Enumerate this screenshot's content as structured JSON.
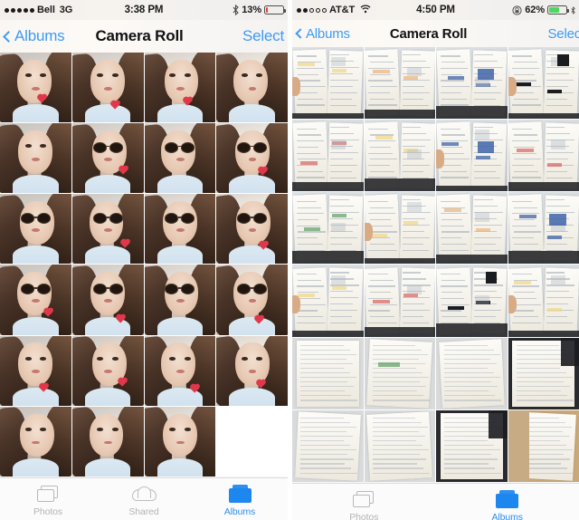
{
  "left_phone": {
    "status_bar": {
      "signal_dots": [
        true,
        true,
        true,
        true,
        true
      ],
      "carrier": "Bell",
      "network": "3G",
      "time": "3:38 PM",
      "bluetooth_icon": "bluetooth-icon",
      "battery_percent": "13%",
      "battery_level": 13,
      "battery_color": "#e8413a"
    },
    "nav_bar": {
      "back_label": "Albums",
      "back_icon": "chevron-left-icon",
      "title": "Camera Roll",
      "select_label": "Select",
      "accent_color": "#3e9bf5"
    },
    "grid": {
      "columns": 4,
      "photo_type": "selfie",
      "photos": [
        {
          "variant": "plain",
          "heart": true
        },
        {
          "variant": "plain",
          "heart": true
        },
        {
          "variant": "plain",
          "heart": true
        },
        {
          "variant": "plain",
          "heart": false
        },
        {
          "variant": "plain",
          "heart": false
        },
        {
          "variant": "shades",
          "heart": true
        },
        {
          "variant": "shades",
          "heart": false
        },
        {
          "variant": "shades",
          "heart": true
        },
        {
          "variant": "shades",
          "heart": false
        },
        {
          "variant": "shades",
          "heart": true
        },
        {
          "variant": "shades",
          "heart": false
        },
        {
          "variant": "shades",
          "heart": true
        },
        {
          "variant": "shades",
          "heart": true
        },
        {
          "variant": "shades",
          "heart": true
        },
        {
          "variant": "shades",
          "heart": false
        },
        {
          "variant": "shades",
          "heart": true
        },
        {
          "variant": "plain",
          "heart": true
        },
        {
          "variant": "plain",
          "heart": true
        },
        {
          "variant": "plain",
          "heart": true
        },
        {
          "variant": "plain",
          "heart": true
        },
        {
          "variant": "plain",
          "heart": false
        },
        {
          "variant": "plain",
          "heart": false
        },
        {
          "variant": "plain",
          "heart": false
        },
        {
          "variant": "empty",
          "heart": false
        }
      ]
    },
    "tab_bar": {
      "tabs": [
        {
          "label": "Photos",
          "icon": "photos-stack-icon",
          "active": false
        },
        {
          "label": "Shared",
          "icon": "cloud-icon",
          "active": false
        },
        {
          "label": "Albums",
          "icon": "album-folder-icon",
          "active": true
        }
      ],
      "active_color": "#2f8ff0",
      "inactive_color": "#b4b4b4"
    }
  },
  "right_phone": {
    "status_bar": {
      "signal_dots": [
        true,
        true,
        false,
        false,
        false
      ],
      "carrier": "AT&T",
      "wifi_icon": "wifi-icon",
      "time": "4:50 PM",
      "rotation_lock_icon": "rotation-lock-icon",
      "battery_percent": "62%",
      "battery_level": 62,
      "battery_color": "#4cd763"
    },
    "nav_bar": {
      "back_label": "Albums",
      "back_icon": "chevron-left-icon",
      "title": "Camera Roll",
      "select_label": "Select",
      "accent_color": "#3e9bf5"
    },
    "grid": {
      "columns": 4,
      "photo_type": "notebook-page",
      "photos": [
        {
          "variant": "spread",
          "accent": "yellow"
        },
        {
          "variant": "spread",
          "accent": "orange"
        },
        {
          "variant": "spread",
          "accent": "blue"
        },
        {
          "variant": "spread",
          "accent": "dark"
        },
        {
          "variant": "spread",
          "accent": "red"
        },
        {
          "variant": "spread",
          "accent": "yellow"
        },
        {
          "variant": "spread",
          "accent": "blue"
        },
        {
          "variant": "spread",
          "accent": "red"
        },
        {
          "variant": "spread",
          "accent": "green"
        },
        {
          "variant": "spread",
          "accent": "yellow"
        },
        {
          "variant": "spread",
          "accent": "orange"
        },
        {
          "variant": "spread",
          "accent": "blue"
        },
        {
          "variant": "spread",
          "accent": "yellow"
        },
        {
          "variant": "spread",
          "accent": "red"
        },
        {
          "variant": "spread",
          "accent": "dark"
        },
        {
          "variant": "spread",
          "accent": "yellow"
        },
        {
          "variant": "lined",
          "accent": "plain"
        },
        {
          "variant": "lined",
          "accent": "green"
        },
        {
          "variant": "lined",
          "accent": "plain"
        },
        {
          "variant": "lined",
          "accent": "dark"
        },
        {
          "variant": "lined",
          "accent": "plain"
        },
        {
          "variant": "lined",
          "accent": "plain"
        },
        {
          "variant": "lined",
          "accent": "dark"
        },
        {
          "variant": "lined",
          "accent": "desk"
        }
      ]
    },
    "tab_bar": {
      "tabs": [
        {
          "label": "Photos",
          "icon": "photos-stack-icon",
          "active": false
        },
        {
          "label": "Albums",
          "icon": "album-folder-icon",
          "active": true
        }
      ],
      "active_color": "#2f8ff0",
      "inactive_color": "#b4b4b4"
    }
  }
}
